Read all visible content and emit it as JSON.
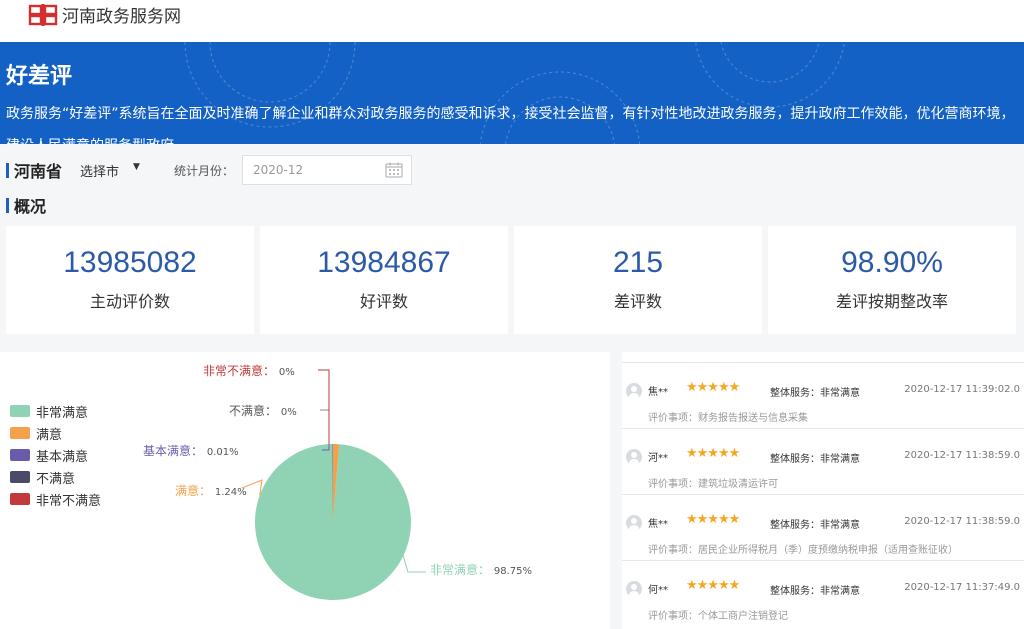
{
  "header": {
    "site_name": "河南政务服务网"
  },
  "banner": {
    "title": "好差评",
    "description": "政务服务“好差评”系统旨在全面及时准确了解企业和群众对政务服务的感受和诉求，接受社会监督，有针对性地改进政务服务，提升政府工作效能，优化营商环境，建设人民满意的服务型政府"
  },
  "filter": {
    "province": "河南省",
    "city_placeholder": "选择市",
    "month_label": "统计月份：",
    "month_value": "2020-12"
  },
  "overview": {
    "title": "概况",
    "stats": [
      {
        "value": "13985082",
        "label": "主动评价数"
      },
      {
        "value": "13984867",
        "label": "好评数"
      },
      {
        "value": "215",
        "label": "差评数"
      },
      {
        "value": "98.90%",
        "label": "差评按期整改率"
      }
    ]
  },
  "chart_data": {
    "type": "pie",
    "legend_position": "left",
    "categories": [
      "非常满意",
      "满意",
      "基本满意",
      "不满意",
      "非常不满意"
    ],
    "values": [
      98.75,
      1.24,
      0.01,
      0,
      0
    ],
    "colors": [
      "#8fd3b4",
      "#f5a04a",
      "#6b5cab",
      "#4a4a6a",
      "#c23a3a"
    ],
    "data_labels": [
      {
        "name": "非常满意",
        "sep": "：",
        "value": "98.75%"
      },
      {
        "name": "满意",
        "sep": "：",
        "value": "1.24%"
      },
      {
        "name": "基本满意",
        "sep": "：",
        "value": "0.01%"
      },
      {
        "name": "不满意",
        "sep": "：",
        "value": "0%"
      },
      {
        "name": "非常不满意",
        "sep": "：",
        "value": "0%"
      }
    ]
  },
  "reviews": [
    {
      "name": "焦**",
      "stars": "★★★★★",
      "overall": "整体服务：非常满意",
      "time": "2020-12-17 11:39:02.0",
      "item": "评价事项：财务报告报送与信息采集"
    },
    {
      "name": "河**",
      "stars": "★★★★★",
      "overall": "整体服务：非常满意",
      "time": "2020-12-17 11:38:59.0",
      "item": "评价事项：建筑垃圾清运许可"
    },
    {
      "name": "焦**",
      "stars": "★★★★★",
      "overall": "整体服务：非常满意",
      "time": "2020-12-17 11:38:59.0",
      "item": "评价事项：居民企业所得税月（季）度预缴纳税申报（适用查账征收）"
    },
    {
      "name": "何**",
      "stars": "★★★★★",
      "overall": "整体服务：非常满意",
      "time": "2020-12-17 11:37:49.0",
      "item": "评价事项：个体工商户注销登记"
    }
  ]
}
